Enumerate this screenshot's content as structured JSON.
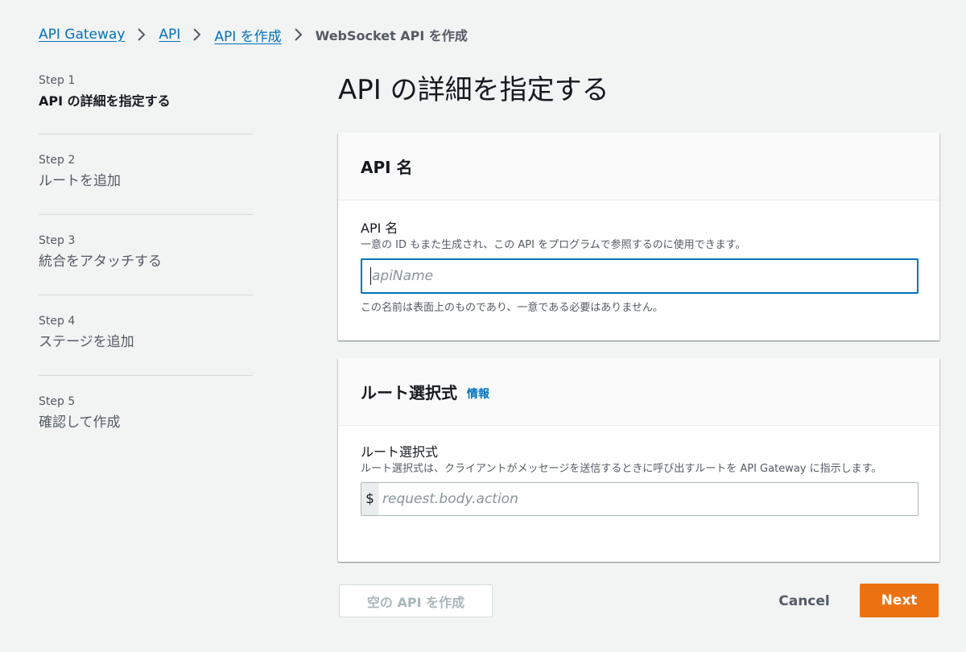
{
  "breadcrumb": {
    "items": [
      "API Gateway",
      "API",
      "API を作成"
    ],
    "current": "WebSocket API を作成"
  },
  "steps": [
    {
      "number": "Step 1",
      "title": "API の詳細を指定する",
      "active": true
    },
    {
      "number": "Step 2",
      "title": "ルートを追加",
      "active": false
    },
    {
      "number": "Step 3",
      "title": "統合をアタッチする",
      "active": false
    },
    {
      "number": "Step 4",
      "title": "ステージを追加",
      "active": false
    },
    {
      "number": "Step 5",
      "title": "確認して作成",
      "active": false
    }
  ],
  "main": {
    "title": "API の詳細を指定する"
  },
  "api_name_panel": {
    "header": "API 名",
    "label": "API 名",
    "description": "一意の ID もまた生成され、この API をプログラムで参照するのに使用できます。",
    "placeholder": "apiName",
    "hint": "この名前は表面上のものであり、一意である必要はありません。"
  },
  "route_panel": {
    "header": "ルート選択式",
    "info_link": "情報",
    "label": "ルート選択式",
    "description": "ルート選択式は、クライアントがメッセージを送信するときに呼び出すルートを API Gateway に指示します。",
    "prefix": "$",
    "placeholder": "request.body.action"
  },
  "footer": {
    "create_empty_label": "空の API を作成",
    "cancel_label": "Cancel",
    "next_label": "Next"
  },
  "colors": {
    "link": "#0073bb",
    "primary_button": "#ec7211",
    "background": "#f2f3f3"
  }
}
